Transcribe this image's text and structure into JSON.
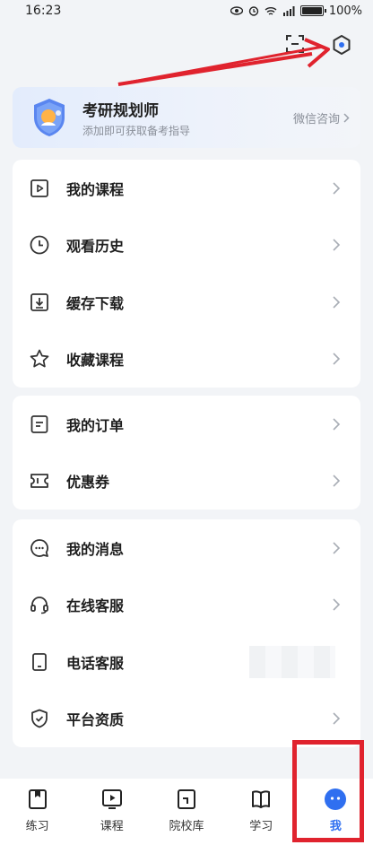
{
  "status_bar": {
    "time": "16:23",
    "battery": "100%"
  },
  "top_actions": {
    "scan_icon": "scan-icon",
    "settings_icon": "settings-hexagon-icon"
  },
  "planner": {
    "title": "考研规划师",
    "subtitle": "添加即可获取备考指导",
    "cta": "微信咨询"
  },
  "menu_groups": [
    {
      "items": [
        {
          "label": "我的课程",
          "icon": "play-box-icon"
        },
        {
          "label": "观看历史",
          "icon": "clock-icon"
        },
        {
          "label": "缓存下载",
          "icon": "download-box-icon"
        },
        {
          "label": "收藏课程",
          "icon": "star-icon"
        }
      ]
    },
    {
      "items": [
        {
          "label": "我的订单",
          "icon": "order-icon"
        },
        {
          "label": "优惠券",
          "icon": "coupon-icon"
        }
      ]
    },
    {
      "items": [
        {
          "label": "我的消息",
          "icon": "message-icon"
        },
        {
          "label": "在线客服",
          "icon": "headset-icon"
        },
        {
          "label": "电话客服",
          "icon": "phone-icon"
        },
        {
          "label": "平台资质",
          "icon": "shield-check-icon"
        }
      ]
    }
  ],
  "tabbar": {
    "tabs": [
      {
        "label": "练习",
        "icon": "practice-icon"
      },
      {
        "label": "课程",
        "icon": "course-icon"
      },
      {
        "label": "院校库",
        "icon": "school-icon"
      },
      {
        "label": "学习",
        "icon": "study-icon"
      },
      {
        "label": "我",
        "icon": "me-icon",
        "active": true
      }
    ]
  },
  "colors": {
    "accent": "#2f6ff0",
    "annotation": "#e0232e",
    "background": "#f2f4f7"
  }
}
